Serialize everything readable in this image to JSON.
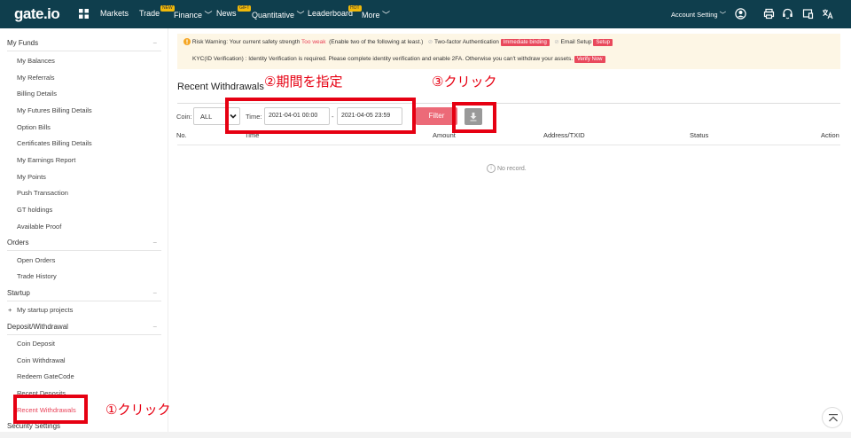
{
  "topbar": {
    "logo": "gate.io",
    "nav": [
      {
        "label": "Markets",
        "badge": ""
      },
      {
        "label": "Trade",
        "badge": "NEW"
      },
      {
        "label": "Finance",
        "badge": ""
      },
      {
        "label": "News",
        "badge": "GIFT"
      },
      {
        "label": "Quantitative",
        "badge": ""
      },
      {
        "label": "Leaderboard",
        "badge": "HOT"
      },
      {
        "label": "More",
        "badge": ""
      }
    ],
    "account_setting": "Account Setting"
  },
  "sidebar": {
    "my_funds": {
      "title": "My Funds",
      "collapse": "−",
      "items": [
        "My Balances",
        "My Referrals",
        "Billing Details",
        "My Futures Billing Details",
        "Option Bills",
        "Certificates Billing Details",
        "My Earnings Report",
        "My Points",
        "Push Transaction",
        "GT holdings",
        "Available Proof"
      ]
    },
    "orders": {
      "title": "Orders",
      "collapse": "−",
      "items": [
        "Open Orders",
        "Trade History"
      ]
    },
    "startup": {
      "title": "Startup",
      "collapse": "−",
      "items": [
        "My startup projects"
      ]
    },
    "deposit": {
      "title": "Deposit/Withdrawal",
      "collapse": "−",
      "items": [
        "Coin Deposit",
        "Coin Withdrawal",
        "Redeem GateCode",
        "Recent Deposits",
        "Recent Withdrawals"
      ]
    },
    "security": {
      "title": "Security Settings"
    }
  },
  "warning": {
    "prefix": "Risk Warning: Your current safety strength",
    "strength": "Too weak",
    "enable_text": "(Enable two of the following at least.)",
    "twofa": "Two-factor Authentication",
    "twofa_btn": "Immediate binding",
    "email": "Email Setup",
    "email_btn": "Setup",
    "kyc_text": "KYC(ID Verification) : Identity Verification is required. Please complete identity verification and enable 2FA. Otherwise you can't withdraw your assets.",
    "kyc_btn": "Verify Now"
  },
  "main": {
    "title": "Recent Withdrawals",
    "coin_label": "Coin:",
    "coin_value": "ALL",
    "time_label": "Time:",
    "date_from": "2021-04-01 00:00",
    "date_sep": "-",
    "date_to": "2021-04-05 23:59",
    "filter": "Filter",
    "columns": [
      "No.",
      "Time",
      "Amount",
      "Address/TXID",
      "Status",
      "Action"
    ],
    "no_record": "No record."
  },
  "annotations": {
    "step1": "①クリック",
    "step2": "②期間を指定",
    "step3": "③クリック"
  },
  "colors": {
    "topbar": "#0f3e4d",
    "accent": "#e94359",
    "annotation": "#e60012"
  }
}
